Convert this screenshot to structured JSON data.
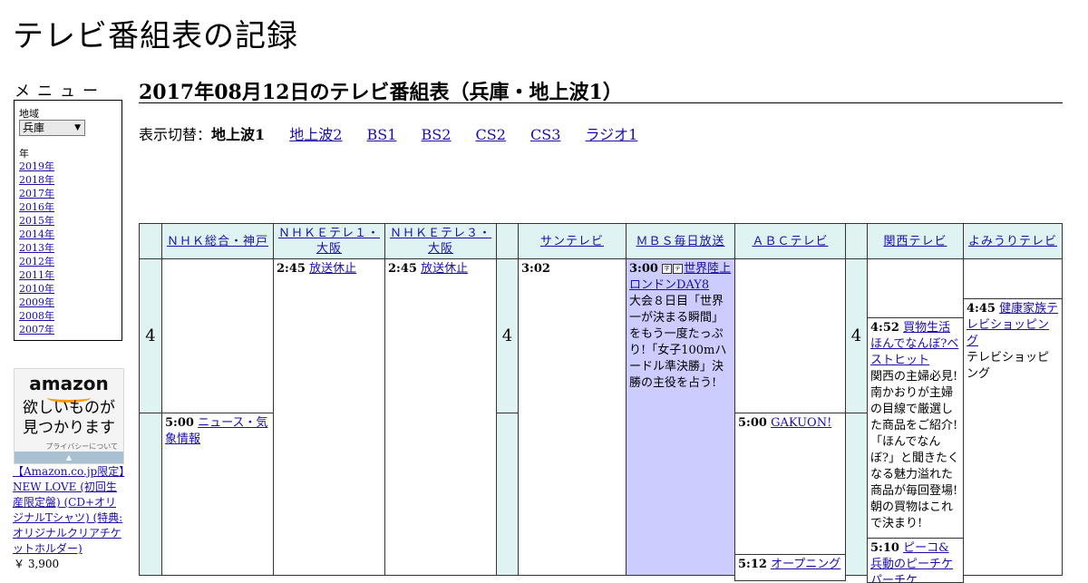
{
  "site_title": "テレビ番組表の記録",
  "menu": {
    "heading": "メニュー",
    "region_label": "地域",
    "region_value": "兵庫",
    "year_label": "年",
    "years": [
      "2019年",
      "2018年",
      "2017年",
      "2016年",
      "2015年",
      "2014年",
      "2013年",
      "2012年",
      "2011年",
      "2010年",
      "2009年",
      "2008年",
      "2007年"
    ]
  },
  "ad": {
    "logo": "amazon",
    "tagline_1": "欲しいものが",
    "tagline_2": "見つかります",
    "privacy": "プライバシーについて",
    "product": "【Amazon.co.jp限定】NEW LOVE (初回生産限定盤) (CD+オリジナルTシャツ) (特典: オリジナルクリアチケットホルダー)",
    "price": "￥ 3,900"
  },
  "page_heading": "2017年08月12日のテレビ番組表（兵庫・地上波1）",
  "switcher": {
    "label": "表示切替：",
    "current": "地上波1",
    "links": [
      "地上波2",
      "BS1",
      "BS2",
      "CS2",
      "CS3",
      "ラジオ1"
    ]
  },
  "channels": [
    "ＮＨＫ総合・神戸",
    "ＮＨＫＥテレ１・大阪",
    "ＮＨＫＥテレ３・大阪",
    "サンテレビ",
    "ＭＢＳ毎日放送",
    "ＡＢＣテレビ",
    "関西テレビ",
    "よみうりテレビ"
  ],
  "hour": "4",
  "programs": {
    "nhk_sogo_1": {
      "time": "5:00",
      "title": "ニュース・気象情報"
    },
    "etele1_1": {
      "time": "2:45",
      "title": "放送休止"
    },
    "etele3_1": {
      "time": "2:45",
      "title": "放送休止"
    },
    "sun_1": {
      "time": "3:02"
    },
    "mbs_1": {
      "time": "3:00",
      "icon_1": "字",
      "icon_2": "デ",
      "title": "世界陸上ロンドンDAY8",
      "desc": "大会８日目「世界一が決まる瞬間」をもう一度たっぷり!「女子100mハードル準決勝」決勝の主役を占う!"
    },
    "abc_1": {
      "time": "5:00",
      "title": "GAKUON!"
    },
    "abc_2": {
      "time": "5:12",
      "title": "オープニング"
    },
    "ktv_1": {
      "time": "4:52",
      "title": "買物生活ほんでなんぼ?ベストヒット",
      "desc": "関西の主婦必見!南かおりが主婦の目線で厳選した商品をご紹介!「ほんでなんぼ?」と聞きたくなる魅力溢れた商品が毎回登場!朝の買物はこれで決まり!"
    },
    "ktv_2": {
      "time": "5:10",
      "title": "ピーコ&兵動のピーチケパーチケ"
    },
    "ytv_1": {
      "time": "4:45",
      "title": "健康家族テレビショッピング",
      "desc": "テレビショッピング"
    }
  }
}
